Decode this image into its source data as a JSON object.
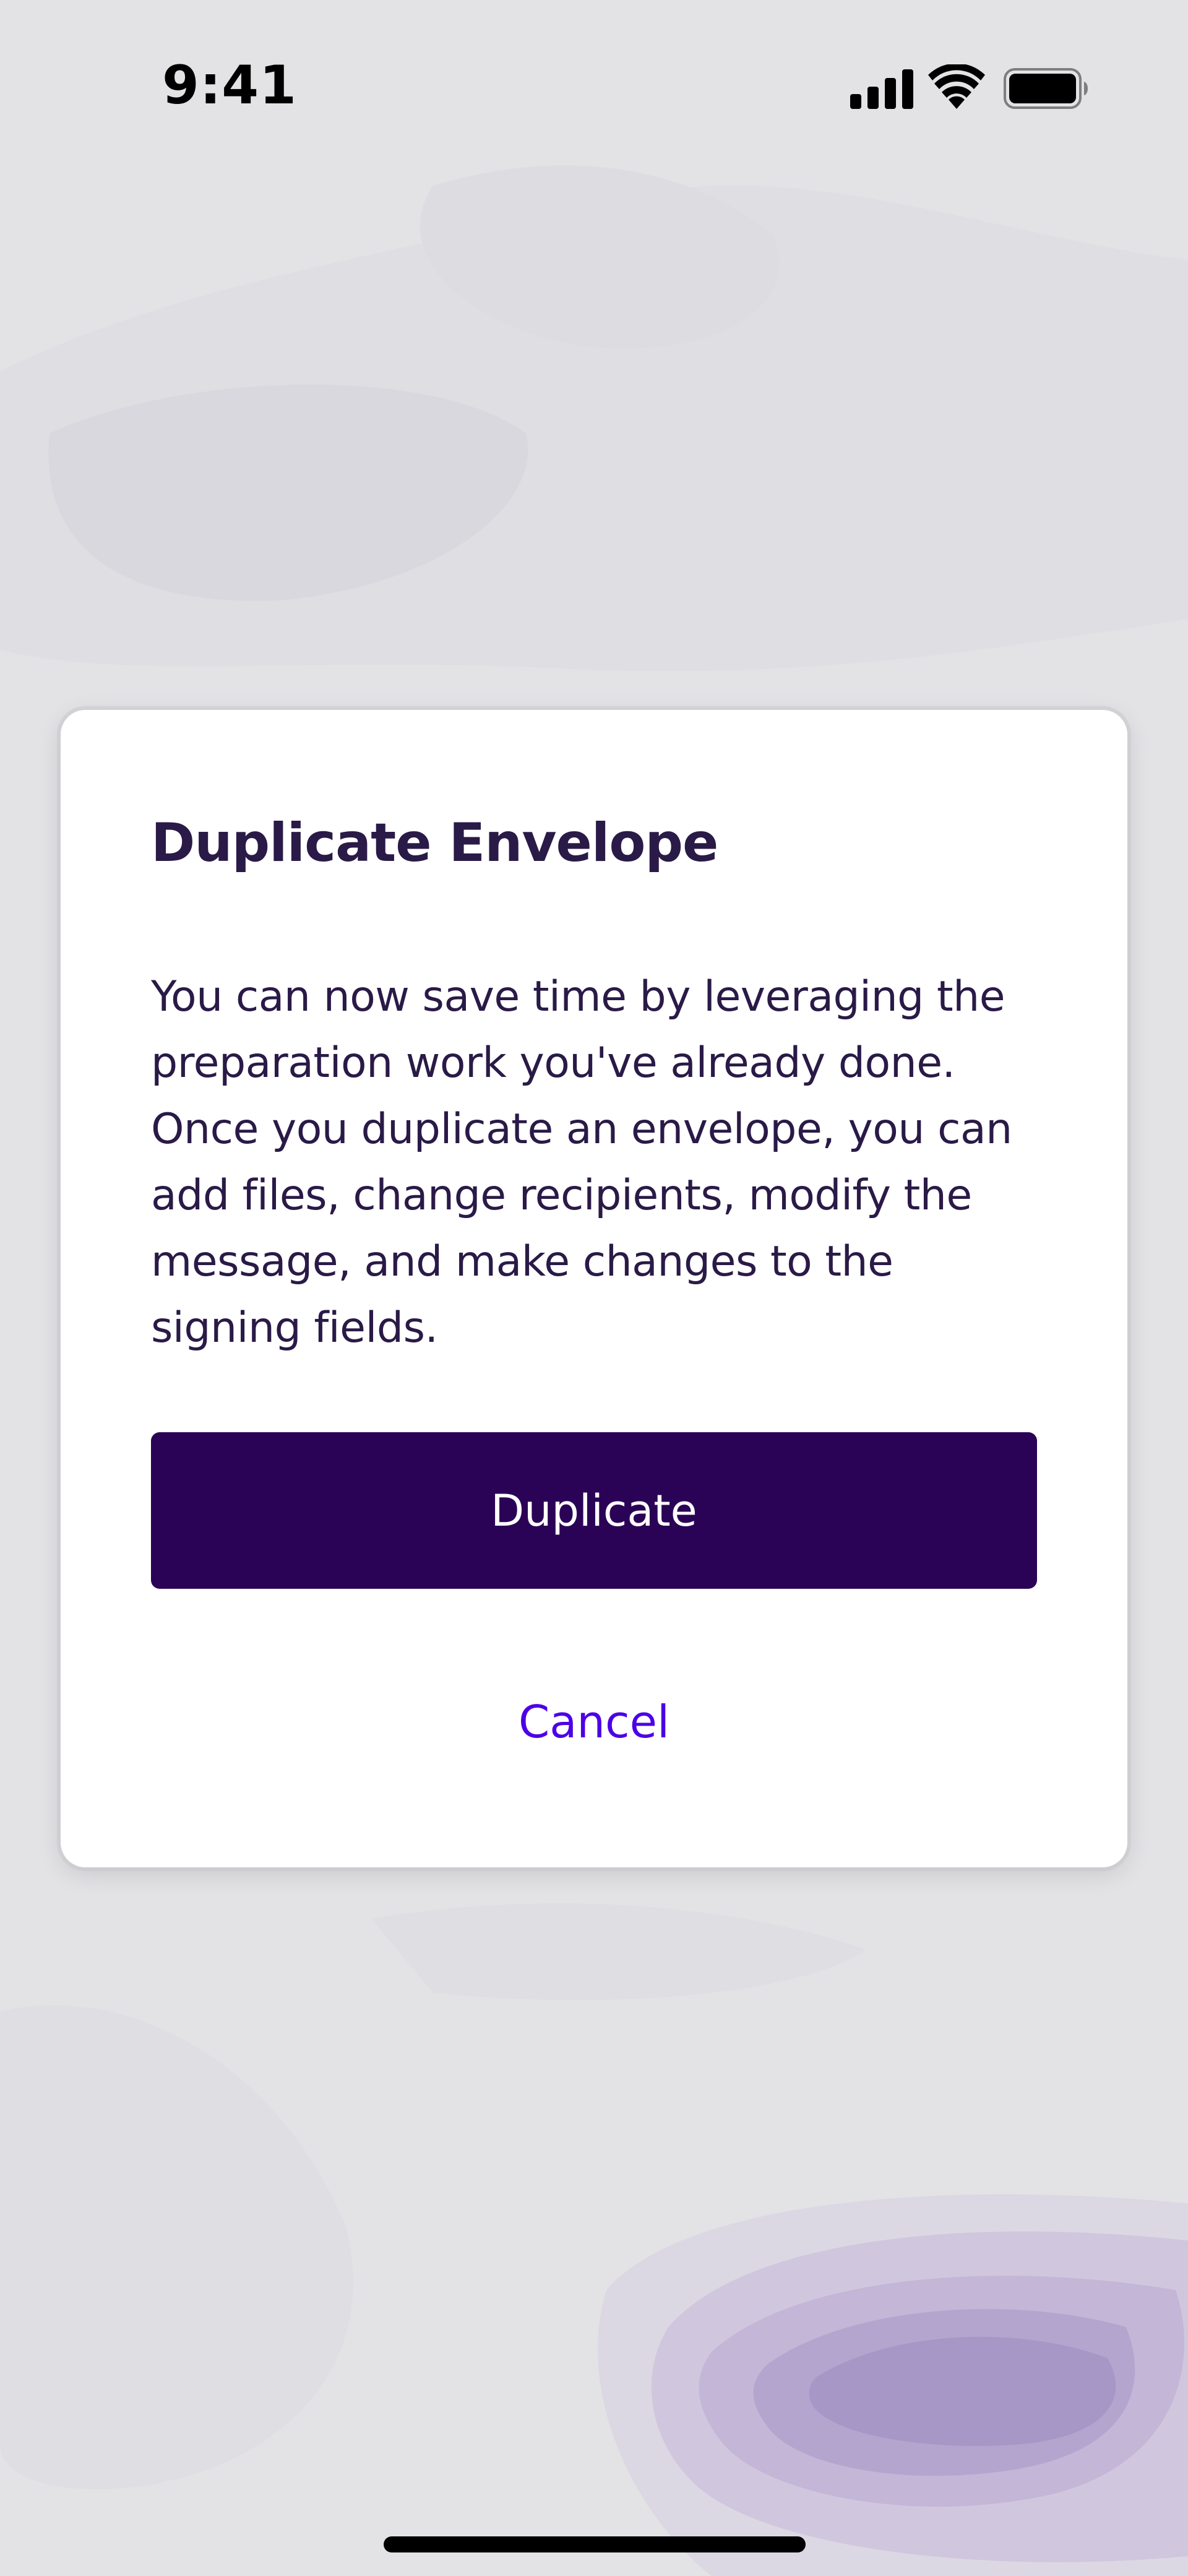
{
  "status_bar": {
    "time": "9:41",
    "icons": [
      "cellular-signal-icon",
      "wifi-icon",
      "battery-icon"
    ]
  },
  "dialog": {
    "title": "Duplicate Envelope",
    "body": "You can now save time by leveraging the preparation work you've already done. Once you duplicate an envelope, you can add files, change recipients, modify the message, and make changes to the signing fields.",
    "primary_button_label": "Duplicate",
    "cancel_button_label": "Cancel"
  },
  "colors": {
    "background": "#e3e3e6",
    "dialog_background": "#ffffff",
    "text": "#2a1a47",
    "primary_button": "#2b0356",
    "link": "#4c00e6",
    "accent_blob": "#a797c7"
  }
}
